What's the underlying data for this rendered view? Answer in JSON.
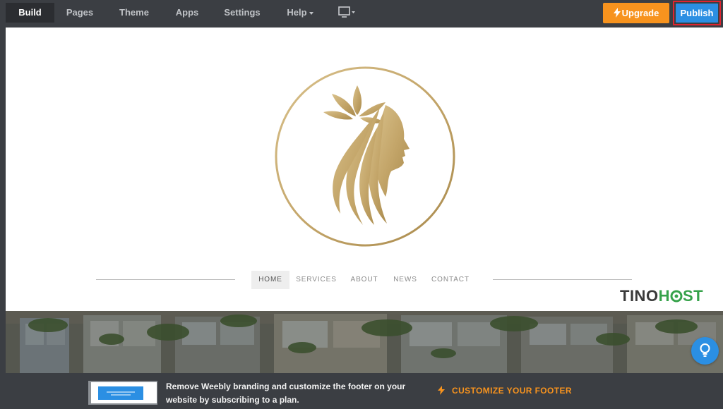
{
  "toolbar": {
    "tabs": [
      {
        "label": "Build"
      },
      {
        "label": "Pages"
      },
      {
        "label": "Theme"
      },
      {
        "label": "Apps"
      },
      {
        "label": "Settings"
      },
      {
        "label": "Help"
      }
    ],
    "upgrade_label": "Upgrade",
    "publish_label": "Publish",
    "accent_orange": "#f7931e",
    "accent_blue": "#2b8fe3"
  },
  "site": {
    "nav": [
      {
        "label": "HOME"
      },
      {
        "label": "SERVICES"
      },
      {
        "label": "ABOUT"
      },
      {
        "label": "NEWS"
      },
      {
        "label": "CONTACT"
      }
    ],
    "logo_color": "#c4a66a"
  },
  "watermark": {
    "part1": "TINO",
    "part2": "H",
    "part3": "ST"
  },
  "footer": {
    "message": "Remove Weebly branding and customize the footer on your website by subscribing to a plan.",
    "cta_label": "CUSTOMIZE YOUR FOOTER"
  }
}
